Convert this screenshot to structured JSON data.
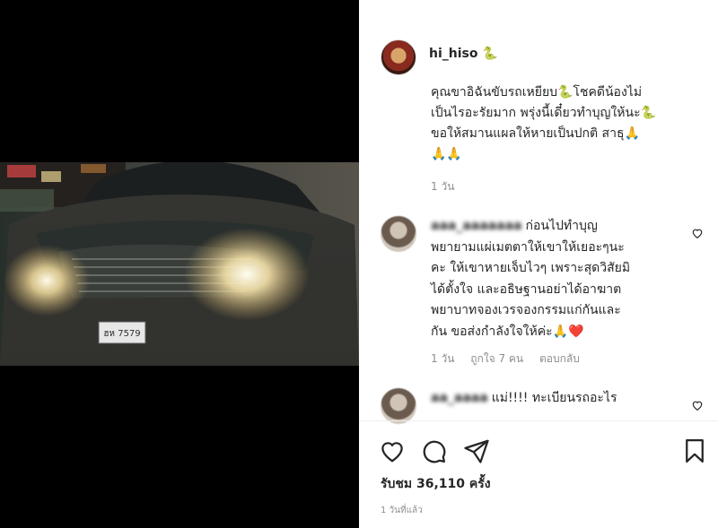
{
  "post": {
    "username": "hi_hiso",
    "username_emoji": "🐍",
    "caption_lines": [
      "คุณขาอิฉันขับรถเหยียบ🐍โชคดีน้องไม่",
      "เป็นไรอะรัยมาก พรุ่งนี้เดี๋ยวทำบุญให้นะ🐍",
      "ขอให้สมานแผลให้หายเป็นปกติ สาธุ🙏",
      "🙏🙏"
    ],
    "caption_time": "1 วัน",
    "video": {
      "plate_text": "ฮห 7579"
    }
  },
  "comments": [
    {
      "username": "aaa_aaaaaaa",
      "text_lines": [
        "ก่อนไปทำบุญ",
        "พยายามแผ่เมตตาให้เขาให้เยอะๆนะ",
        "คะ ให้เขาหายเจ็บไวๆ เพราะสุดวิสัยมิ",
        "ได้ตั้งใจ และอธิษฐานอย่าได้อาฆาต",
        "พยาบาทจองเวรจองกรรมแก่กันและ",
        "กัน ขอส่งกำลังใจให้ค่ะ🙏❤️"
      ],
      "time": "1 วัน",
      "likes": "ถูกใจ 7 คน",
      "reply": "ตอบกลับ",
      "heart_icon": "heart-outline-icon"
    },
    {
      "username": "aa_aaaa",
      "text_lines": [
        "แม่!!!! ทะเบียนรถอะไร"
      ],
      "heart_icon": "heart-outline-icon"
    }
  ],
  "actions": {
    "icons": [
      "heart-icon",
      "comment-icon",
      "share-icon",
      "bookmark-icon"
    ]
  },
  "stats": {
    "views": "รับชม 36,110 ครั้ง",
    "posted": "1 วันที่แล้ว"
  }
}
